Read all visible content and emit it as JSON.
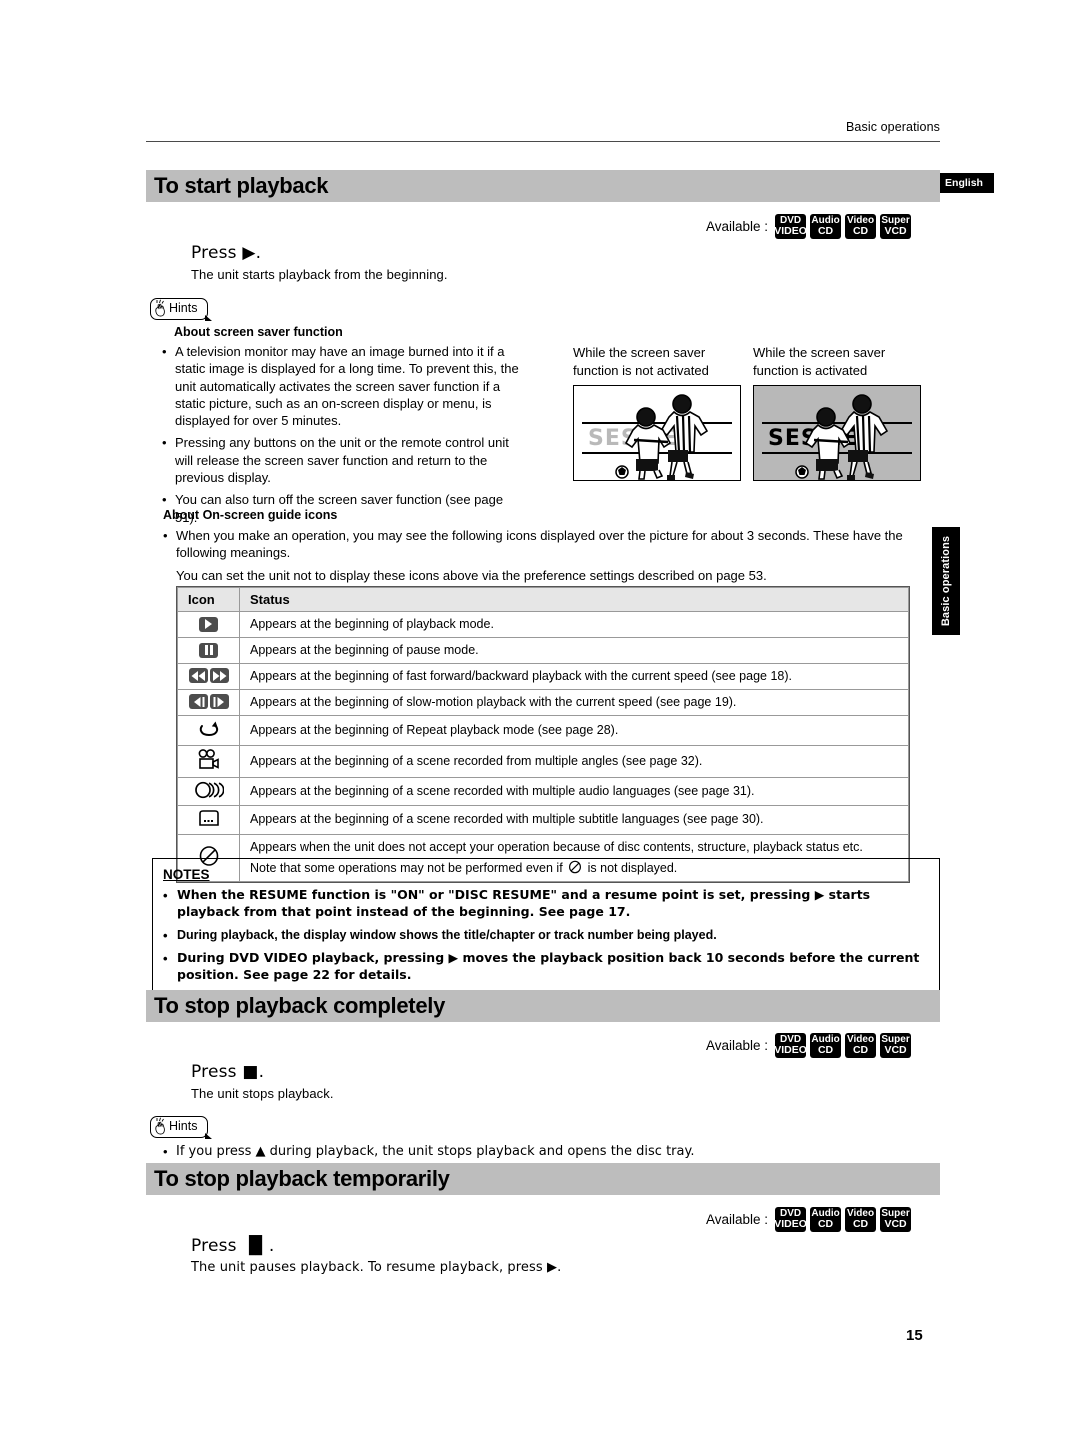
{
  "page": {
    "header_text": "Basic operations",
    "language_tab": "English",
    "side_tab": "Basic operations",
    "page_number": "15"
  },
  "available": {
    "label": "Available :",
    "badges": [
      {
        "name": "dvd-video",
        "line1": "DVD",
        "line2": "VIDEO"
      },
      {
        "name": "audio-cd",
        "line1": "Audio",
        "line2": "CD"
      },
      {
        "name": "video-cd",
        "line1": "Video",
        "line2": "CD"
      },
      {
        "name": "super-vcd",
        "line1": "Super",
        "line2": "VCD"
      }
    ]
  },
  "sections": {
    "start": {
      "title": "To start playback",
      "press": "Press ▶.",
      "desc": "The unit starts playback from the beginning."
    },
    "stop": {
      "title": "To stop playback completely",
      "press": "Press ■.",
      "desc": "The unit stops playback.",
      "hint_bullet": "If you press ▲ during playback, the unit stops playback and opens the disc tray."
    },
    "pause": {
      "title": "To stop playback temporarily",
      "press": "Press ▐▌.",
      "desc": "The unit pauses playback. To resume playback, press ▶."
    }
  },
  "hints": {
    "label": "Hints",
    "screen_saver": {
      "sub_title": "About screen saver function",
      "bullets": [
        "A television monitor may have an image burned into it if a static image is displayed for a long time. To prevent this, the unit automatically activates the screen saver function if a static picture, such as an on-screen display or menu, is displayed for over 5 minutes.",
        "Pressing any buttons on the unit or the remote control unit will release the screen saver function and return to the previous display.",
        "You can also turn off the screen saver function (see page 51)."
      ]
    },
    "guide_icons": {
      "sub_title": "About On-screen guide icons",
      "bullets": [
        "When you make an operation, you may see the following icons displayed over the picture for about 3 seconds. These have the following meanings."
      ],
      "paragraph": "You can set the unit not to display these icons above via the preference settings described on page 53."
    }
  },
  "screen_saver_illustration": {
    "left": {
      "caption": "While the screen saver function is not activated",
      "overlay_text": "SESSIE",
      "state": "faint"
    },
    "right": {
      "caption": "While the screen saver function is activated",
      "overlay_text": "SESSIE",
      "state": "strong"
    }
  },
  "icon_table": {
    "headers": [
      "Icon",
      "Status"
    ],
    "rows": [
      {
        "icon": "play-icon",
        "status": "Appears at the beginning of playback mode."
      },
      {
        "icon": "pause-icon",
        "status": "Appears at the beginning of pause mode."
      },
      {
        "icon": "fast-forward-backward-icon",
        "status": "Appears at the beginning of fast forward/backward playback with the current speed (see page 18)."
      },
      {
        "icon": "slow-motion-icon",
        "status": "Appears at the beginning of slow-motion playback with the current speed (see page 19)."
      },
      {
        "icon": "repeat-icon",
        "status": "Appears at the beginning of Repeat playback mode (see page 28)."
      },
      {
        "icon": "multi-angle-camera-icon",
        "status": "Appears at the beginning of a scene recorded from multiple angles (see page 32)."
      },
      {
        "icon": "multi-audio-icon",
        "status": "Appears at the beginning of a scene recorded with multiple audio languages (see page 31)."
      },
      {
        "icon": "subtitle-icon",
        "status": "Appears at the beginning of a scene recorded with multiple subtitle languages (see page 30)."
      },
      {
        "icon": "prohibited-icon",
        "status": "Appears when the unit does not accept your operation because of disc contents, structure, playback status etc.",
        "status2_pre": "Note that some operations may not be performed even if",
        "status2_post": "is not displayed."
      }
    ]
  },
  "notes": {
    "title": "NOTES",
    "bullets": [
      "When the RESUME function is \"ON\" or \"DISC RESUME\" and a resume point is set, pressing ▶ starts playback from that point instead of the beginning. See page 17.",
      "During playback, the display window shows the title/chapter or track number being played.",
      "During DVD VIDEO playback, pressing ▶ moves the playback position back 10 seconds before the current position. See page 22 for details."
    ]
  },
  "colors": {
    "heading_bar": "#bdbdbd",
    "tab_black": "#000000",
    "table_header": "#e6e6e6",
    "dim_screen": "#b8b8b8"
  }
}
